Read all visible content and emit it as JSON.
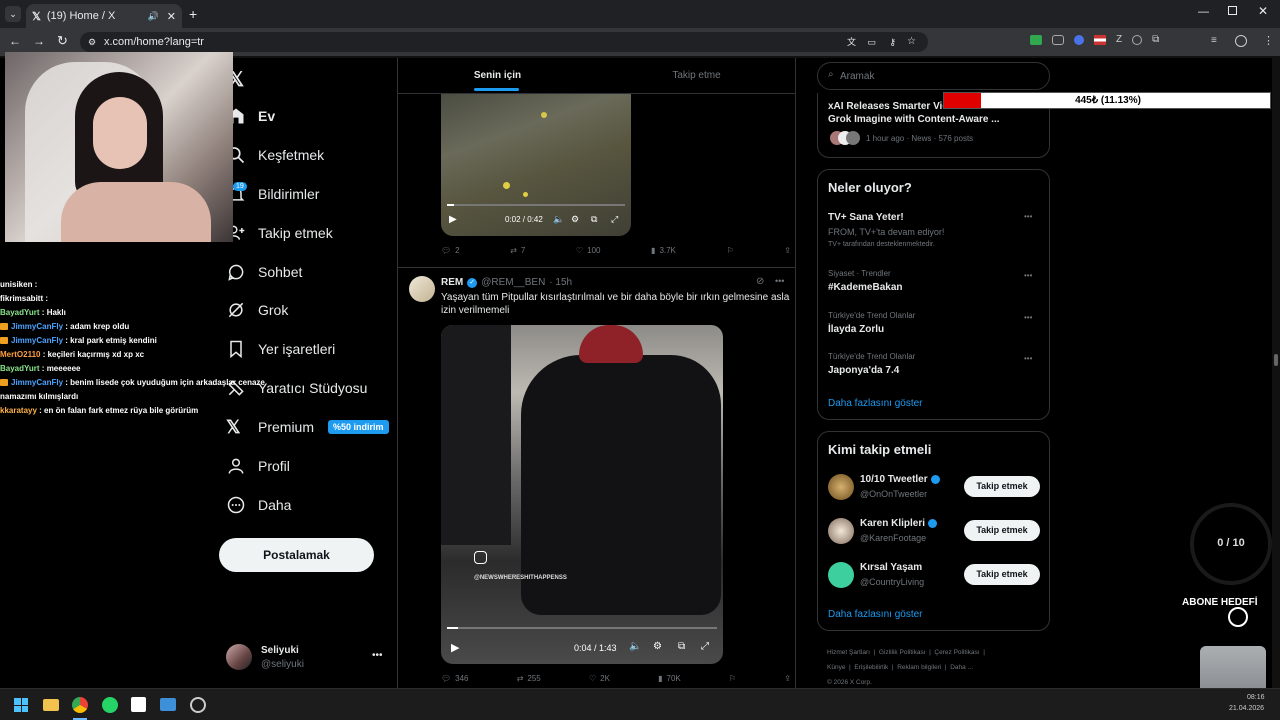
{
  "browser": {
    "tab_title": "(19) Home / X",
    "url": "x.com/home?lang=tr"
  },
  "stream": {
    "donation_bar": "445₺ (11.13%)",
    "donation_fraction": 0.1113,
    "goal_counter": "0 / 10",
    "goal_label": "ABONE HEDEFİ",
    "chat": [
      {
        "user": "unisiken",
        "text": " : ",
        "color": "#ffffff",
        "badge": false
      },
      {
        "user": "fikrimsabitt",
        "text": " : ",
        "color": "#ffffff",
        "badge": false
      },
      {
        "user": "BayadYurt",
        "text": " : Haklı",
        "color": "#8be58b",
        "badge": false
      },
      {
        "user": "JimmyCanFly",
        "text": " : adam krep oldu",
        "color": "#4da3ff",
        "badge": true
      },
      {
        "user": "JimmyCanFly",
        "text": " : kral park etmiş kendini",
        "color": "#4da3ff",
        "badge": true
      },
      {
        "user": "MertO2110",
        "text": " : keçileri kaçırmış xd xp xc",
        "color": "#ff9f40",
        "badge": false
      },
      {
        "user": "BayadYurt",
        "text": " : meeeeee",
        "color": "#8be58b",
        "badge": false
      },
      {
        "user": "JimmyCanFly",
        "text": " : benim lisede çok uyuduğum için arkadaşlar cenaze",
        "color": "#4da3ff",
        "badge": true
      },
      {
        "user": "",
        "text": "namazımı kılmışlardı",
        "color": "#ffffff",
        "badge": false
      },
      {
        "user": "kkaratayy",
        "text": " : en ön falan fark etmez rüya bile görürüm",
        "color": "#ffb347",
        "badge": false
      }
    ]
  },
  "nav": {
    "items": [
      {
        "label": "Ev",
        "icon": "home-icon"
      },
      {
        "label": "Keşfetmek",
        "icon": "search-icon"
      },
      {
        "label": "Bildirimler",
        "icon": "bell-icon"
      },
      {
        "label": "Takip etmek",
        "icon": "follow-icon"
      },
      {
        "label": "Sohbet",
        "icon": "chat-icon"
      },
      {
        "label": "Grok",
        "icon": "grok-icon"
      },
      {
        "label": "Yer işaretleri",
        "icon": "bookmark-icon"
      },
      {
        "label": "Yaratıcı Stüdyosu",
        "icon": "studio-icon"
      },
      {
        "label": "Premium",
        "icon": "x-logo-icon"
      },
      {
        "label": "Profil",
        "icon": "profile-icon"
      },
      {
        "label": "Daha",
        "icon": "more-icon"
      }
    ],
    "notification_count": "19",
    "premium_badge": "%50 indirim",
    "post_button": "Postalamak",
    "account_name": "Seliyuki",
    "account_handle": "@seliyuki"
  },
  "feed": {
    "tab_for_you": "Senin için",
    "tab_following": "Takip etme",
    "post1": {
      "video_time": "0:02 / 0:42",
      "replies": "2",
      "reposts": "7",
      "likes": "100",
      "views": "3.7K"
    },
    "post2": {
      "name": "REM",
      "handle": "@REM__BEN",
      "time": "· 15h",
      "text": "Yaşayan tüm Pitpullar kısırlaştırılmalı ve bir daha böyle bir ırkın gelmesine asla izin verilmemeli",
      "watermark": "@NEWSWHERESHITHAPPENSS",
      "video_time": "0:04 / 1:43",
      "replies": "346",
      "reposts": "255",
      "likes": "2K",
      "views": "70K"
    }
  },
  "right": {
    "search_placeholder": "Aramak",
    "news_title": "xAI Releases Smarter Video Extensions for Grok Imagine with Content-Aware ...",
    "news_meta": "1 hour ago · News · 576 posts",
    "whats_happening": "Neler oluyor?",
    "promo_title": "TV+ Sana Yeter!",
    "promo_sub": "FROM, TV+'ta devam ediyor!",
    "promo_note": "TV+ tarafından desteklenmektedir.",
    "trends": [
      {
        "meta": "Siyaset · Trendler",
        "title": "#KademeBakan"
      },
      {
        "meta": "Türkiye'de Trend Olanlar",
        "title": "İlayda Zorlu"
      },
      {
        "meta": "Türkiye'de Trend Olanlar",
        "title": "Japonya'da 7.4"
      }
    ],
    "show_more": "Daha fazlasını göster",
    "who_to_follow": "Kimi takip etmeli",
    "follow": [
      {
        "name": "10/10 Tweetler",
        "handle": "@OnOnTweetler"
      },
      {
        "name": "Karen Klipleri",
        "handle": "@KarenFootage"
      },
      {
        "name": "Kırsal Yaşam",
        "handle": "@CountryLiving"
      }
    ],
    "follow_button": "Takip etmek",
    "show_more2": "Daha fazlasını göster",
    "footer": [
      "Hizmet Şartları",
      "Gizlilik Politikası",
      "Çerez Politikası",
      "Künye",
      "Erişilebilirlik",
      "Reklam bilgileri",
      "Daha ...",
      "© 2026 X Corp."
    ]
  },
  "taskbar": {
    "time": "08:16",
    "date": "21.04.2026"
  }
}
